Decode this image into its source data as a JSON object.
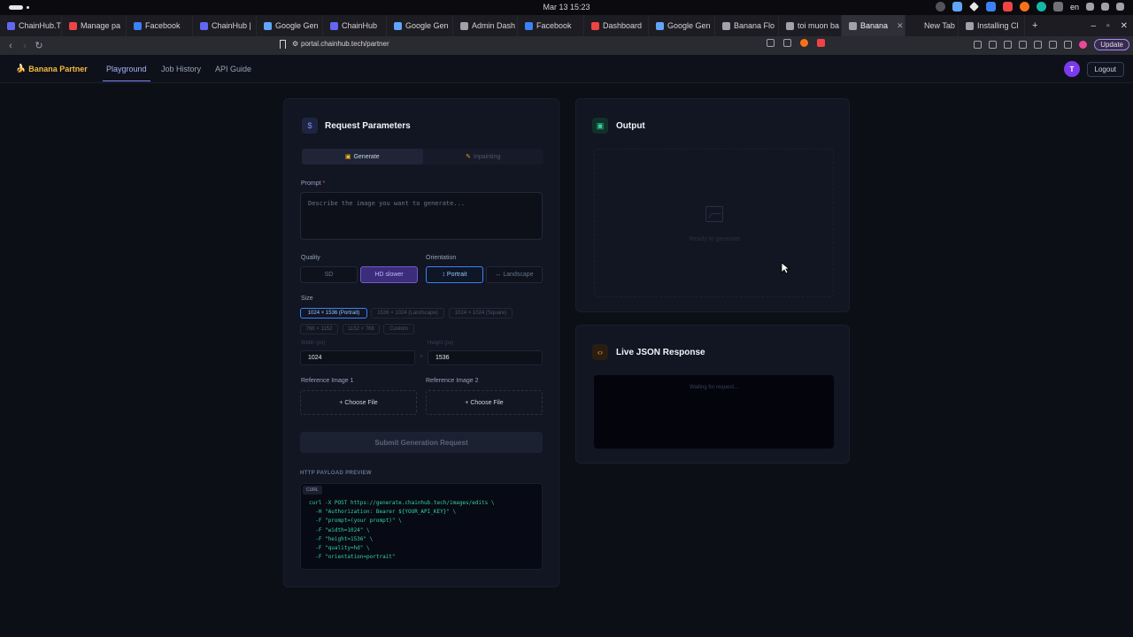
{
  "system": {
    "clock": "Mar 13  15:23",
    "lang": "en"
  },
  "browser": {
    "tabs": [
      {
        "label": "ChainHub.T",
        "color": "#6366f1"
      },
      {
        "label": "Manage pa",
        "color": "#ef4444"
      },
      {
        "label": "Facebook",
        "color": "#3b82f6"
      },
      {
        "label": "ChainHub |",
        "color": "#6366f1"
      },
      {
        "label": "Google Gen",
        "color": "#60a5fa"
      },
      {
        "label": "ChainHub",
        "color": "#6366f1"
      },
      {
        "label": "Google Gen",
        "color": "#60a5fa"
      },
      {
        "label": "Admin Dash",
        "color": "#a1a1aa"
      },
      {
        "label": "Facebook",
        "color": "#3b82f6"
      },
      {
        "label": "Dashboard",
        "color": "#ef4444"
      },
      {
        "label": "Google Gen",
        "color": "#60a5fa"
      },
      {
        "label": "Banana Flo",
        "color": "#a1a1aa"
      },
      {
        "label": "toi muon ba",
        "color": "#a1a1aa"
      },
      {
        "label": "Banana",
        "color": "#a1a1aa",
        "active": true
      },
      {
        "label": "New Tab",
        "color": "#1c1c22"
      },
      {
        "label": "Installing Cl",
        "color": "#a1a1aa"
      }
    ],
    "url": "portal.chainhub.tech/partner",
    "update_label": "Update"
  },
  "app": {
    "brand": "Banana Partner",
    "nav": {
      "playground": "Playground",
      "job_history": "Job History",
      "api_guide": "API Guide"
    },
    "avatar_initial": "T",
    "logout": "Logout"
  },
  "request": {
    "title": "Request Parameters",
    "tabs": {
      "generate": "Generate",
      "inpainting": "Inpainting"
    },
    "prompt_label": "Prompt",
    "prompt_required": "*",
    "prompt_placeholder": "Describe the image you want to generate...",
    "quality_label": "Quality",
    "quality_sd": "SD",
    "quality_hd": "HD slower",
    "orientation_label": "Orientation",
    "orientation_portrait": "↕ Portrait",
    "orientation_landscape": "↔ Landscape",
    "size_label": "Size",
    "sizes": [
      "1024 × 1536 (Portrait)",
      "1536 × 1024 (Landscape)",
      "1024 × 1024 (Square)",
      "768 × 1152",
      "1152 × 768",
      "Custom"
    ],
    "width_label": "Width (px)",
    "height_label": "Height (px)",
    "width_value": "1024",
    "height_value": "1536",
    "times": "×",
    "ref1_label": "Reference Image 1",
    "ref2_label": "Reference Image 2",
    "choose_file": "+ Choose File",
    "submit": "Submit Generation Request",
    "payload_title": "HTTP PAYLOAD PREVIEW",
    "payload_tag": "CURL",
    "payload_code": "curl -X POST https://generate.chainhub.tech/images/edits \\\n  -H \"Authorization: Bearer ${YOUR_API_KEY}\" \\\n  -F \"prompt=(your prompt)\" \\\n  -F \"width=1024\" \\\n  -F \"height=1536\" \\\n  -F \"quality=hd\" \\\n  -F \"orientation=portrait\""
  },
  "output": {
    "title": "Output",
    "ready": "Ready to generate"
  },
  "live_json": {
    "title": "Live JSON Response",
    "waiting": "Waiting for request..."
  }
}
